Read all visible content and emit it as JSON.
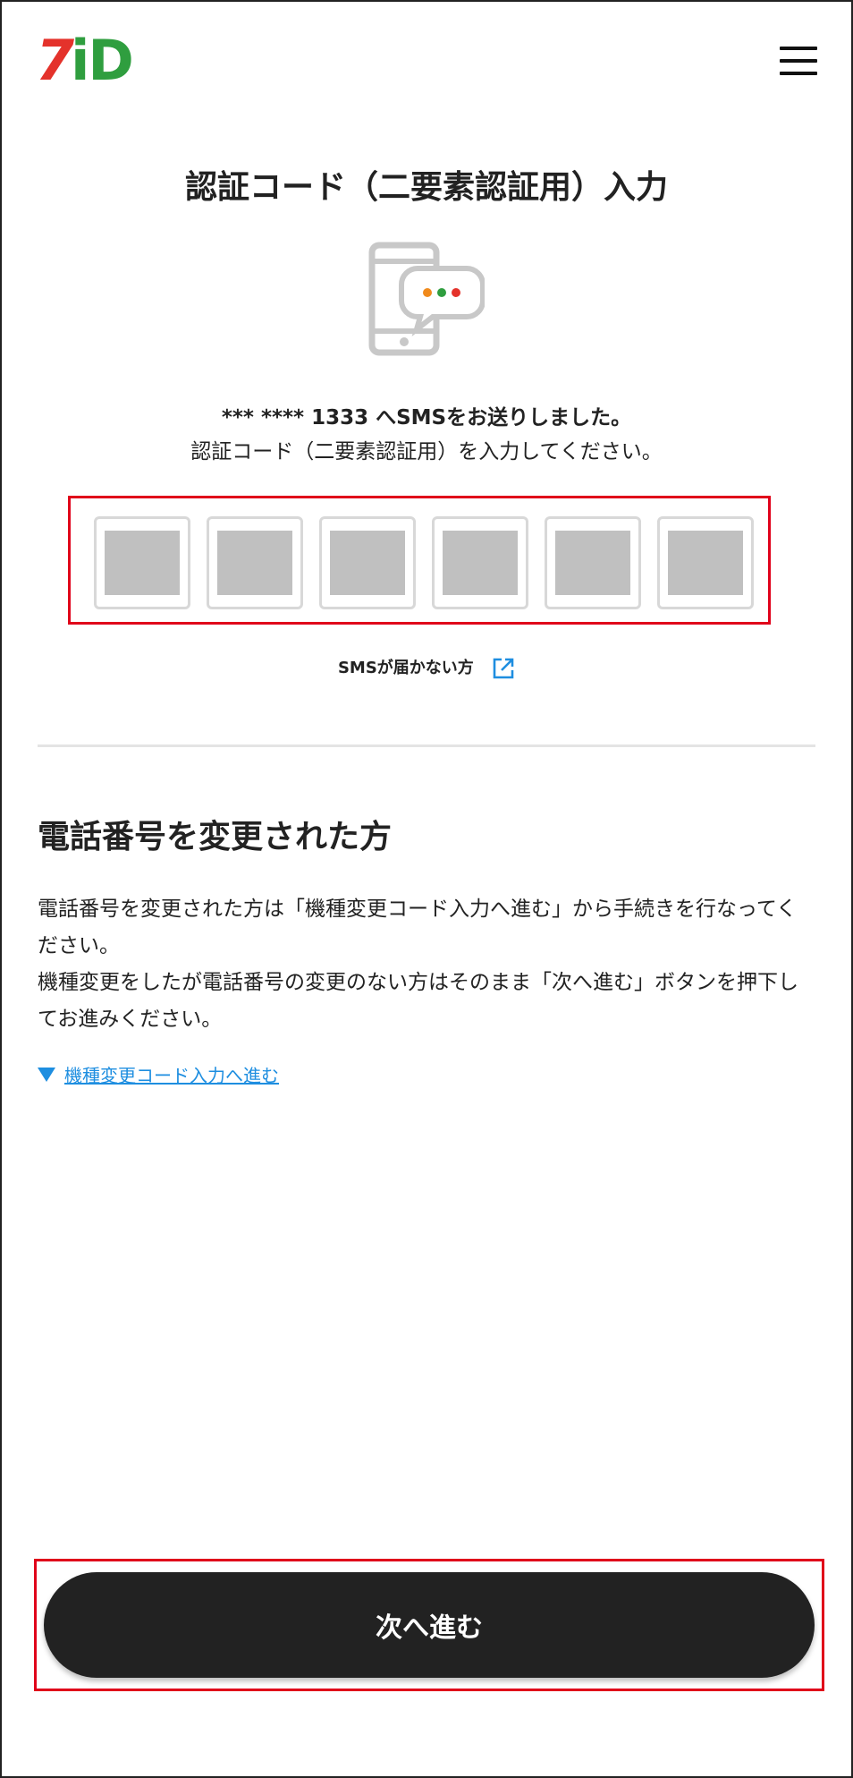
{
  "header": {
    "logo": {
      "part1": "7",
      "part2": "i",
      "part3": "D"
    },
    "menu_icon": "hamburger-menu-icon"
  },
  "page_title": "認証コード（二要素認証用）入力",
  "message": {
    "line1": "*** **** 1333 へSMSをお送りしました。",
    "line2": "認証コード（二要素認証用）を入力してください。"
  },
  "code_inputs": [
    {
      "value": ""
    },
    {
      "value": ""
    },
    {
      "value": ""
    },
    {
      "value": ""
    },
    {
      "value": ""
    },
    {
      "value": ""
    }
  ],
  "sms_not_received": {
    "label": "SMSが届かない方",
    "icon": "external-link-icon"
  },
  "phone_change": {
    "heading": "電話番号を変更された方",
    "paragraph1": "電話番号を変更された方は「機種変更コード入力へ進む」から手続きを行なってください。",
    "paragraph2": "機種変更をしたが電話番号の変更のない方はそのまま「次へ進む」ボタンを押下してお進みください。",
    "link_label": "機種変更コード入力へ進む"
  },
  "next_button": {
    "label": "次へ進む"
  },
  "colors": {
    "logo_red": "#e4322b",
    "logo_green": "#2f9e3f",
    "highlight_red": "#e0001a",
    "link_blue": "#1e8ee0",
    "button_dark": "#222222"
  }
}
